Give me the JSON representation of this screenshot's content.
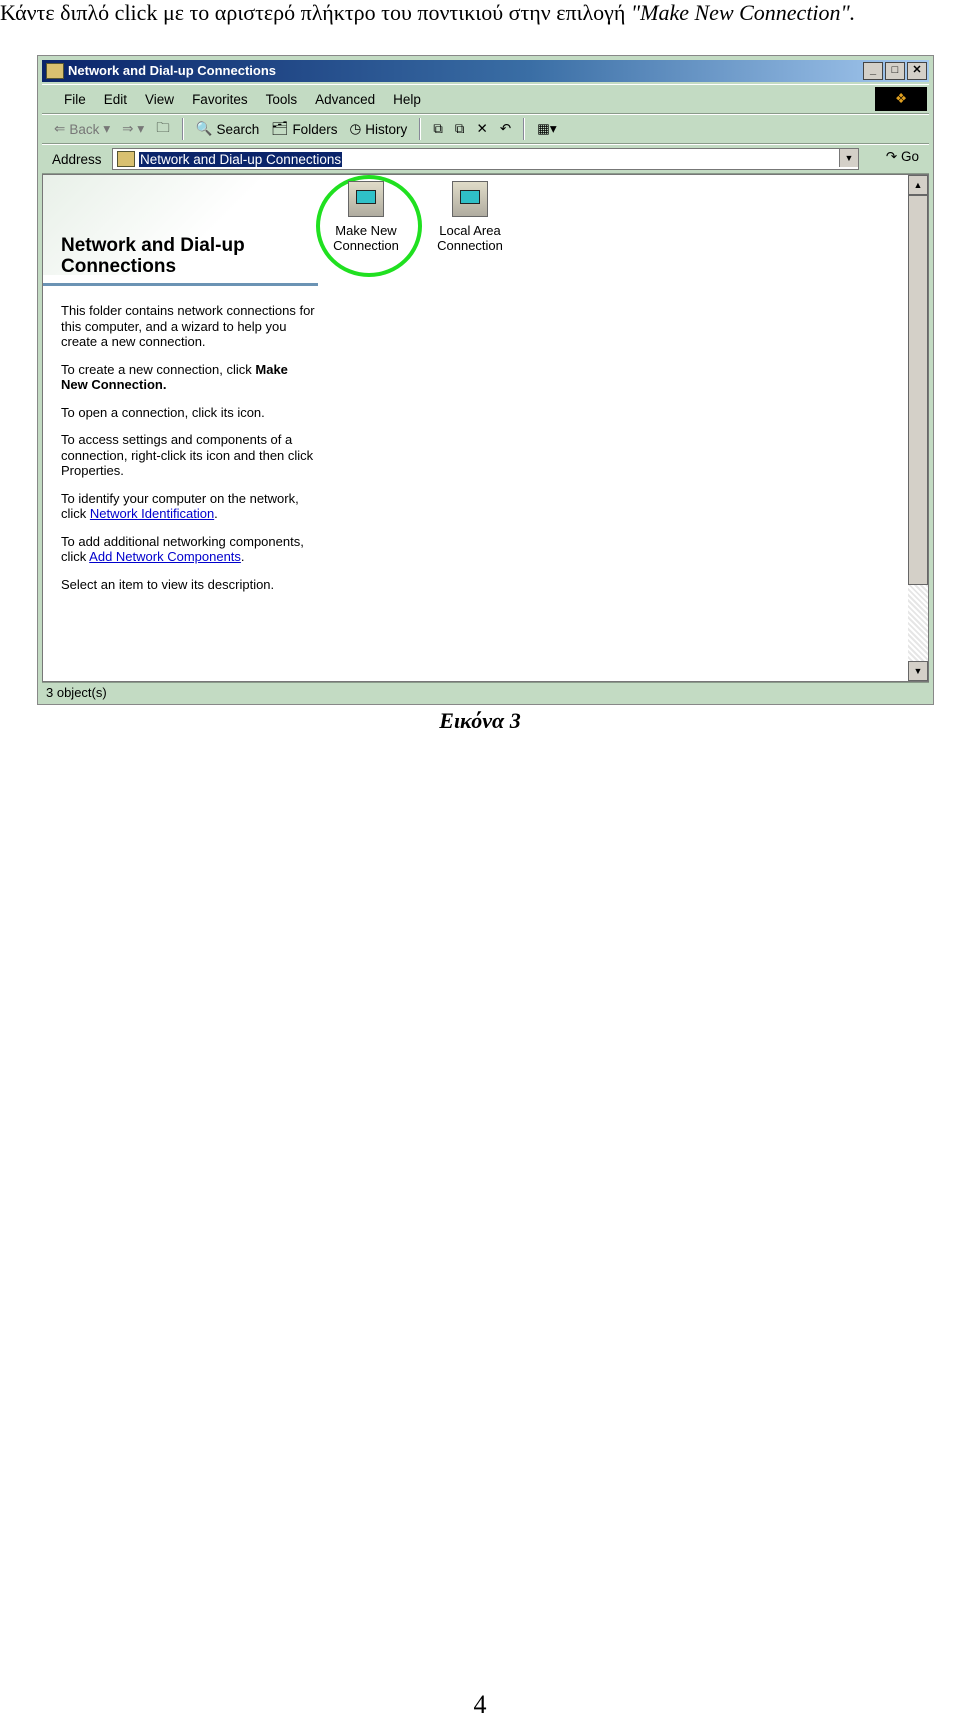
{
  "document": {
    "instruction": "Κάντε διπλό click με το αριστερό πλήκτρο του ποντικιού στην επιλογή ",
    "instruction_quote": "\"Make New Connection\".",
    "caption": "Εικόνα 3",
    "page_number": "4"
  },
  "window": {
    "title": "Network and Dial-up Connections",
    "controls": [
      "_",
      "□",
      "✕"
    ],
    "menu": [
      "File",
      "Edit",
      "View",
      "Favorites",
      "Tools",
      "Advanced",
      "Help"
    ],
    "toolbar": {
      "back": "Back",
      "search": "Search",
      "folders": "Folders",
      "history": "History"
    },
    "address": {
      "label": "Address",
      "value": "Network and Dial-up Connections",
      "go": "Go"
    },
    "panel": {
      "title": "Network and Dial-up Connections",
      "p1": "This folder contains network connections for this computer, and a wizard to help you create a new connection.",
      "p2a": "To create a new connection, click ",
      "p2b": "Make New Connection.",
      "p3": "To open a connection, click its icon.",
      "p4": "To access settings and components of a connection, right-click its icon and then click Properties.",
      "p5a": "To identify your computer on the network, click ",
      "p5link": "Network Identification",
      "p5b": ".",
      "p6a": "To add additional networking components, click ",
      "p6link": "Add Network Components",
      "p6b": ".",
      "p7": "Select an item to view its description."
    },
    "icons": [
      {
        "label": "Make New Connection",
        "icon": "make-new-connection-icon"
      },
      {
        "label": "Local Area Connection",
        "icon": "lan-connection-icon"
      }
    ],
    "highlight_color": "#20e020",
    "status": "3 object(s)"
  }
}
